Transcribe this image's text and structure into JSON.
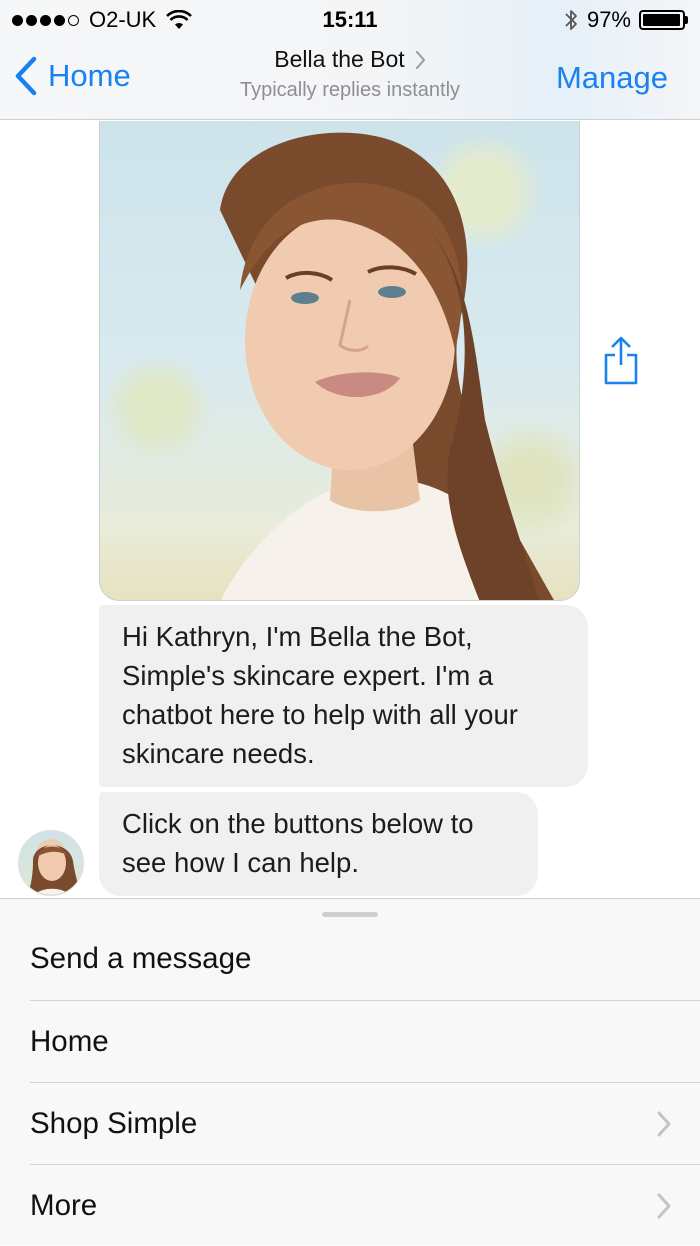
{
  "status_bar": {
    "carrier": "O2-UK",
    "time": "15:11",
    "battery_percent": "97%",
    "battery_level": 0.97,
    "signal_bars_filled": 4,
    "signal_bars_total": 5
  },
  "nav": {
    "back_label": "Home",
    "title": "Bella the Bot",
    "subtitle": "Typically replies instantly",
    "manage_label": "Manage",
    "accent_color": "#1a82f0"
  },
  "messages": [
    "Hi Kathryn, I'm Bella the Bot, Simple's skincare expert. I'm a chatbot here to help with all your skincare needs.",
    "Click on the buttons below to see how I can help."
  ],
  "menu": {
    "items": [
      {
        "label": "Send a message",
        "has_chevron": false
      },
      {
        "label": "Home",
        "has_chevron": false
      },
      {
        "label": "Shop Simple",
        "has_chevron": true
      },
      {
        "label": "More",
        "has_chevron": true
      }
    ]
  },
  "icons": {
    "back": "chevron-left-icon",
    "share": "share-icon",
    "wifi": "wifi-icon",
    "bluetooth": "bluetooth-icon",
    "battery": "battery-icon"
  }
}
